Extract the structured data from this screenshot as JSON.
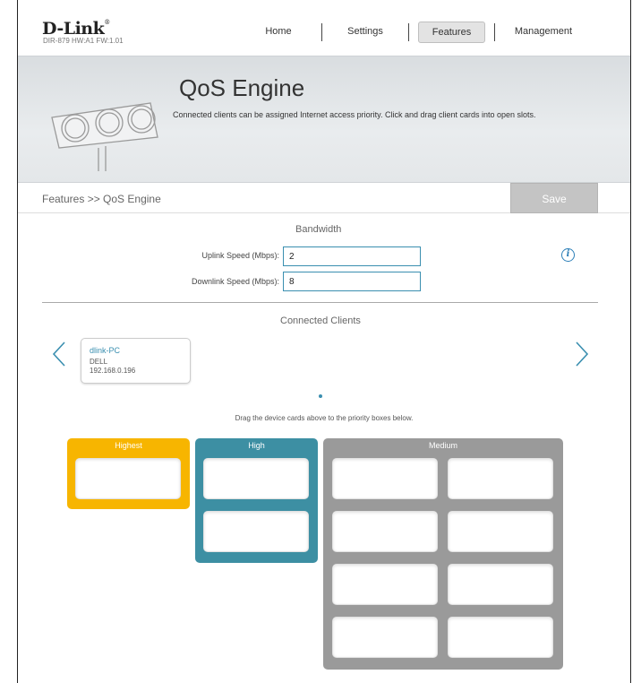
{
  "header": {
    "brand": "D-Link",
    "brand_mark": "®",
    "model_info": "DIR-879 HW:A1 FW:1.01",
    "nav": {
      "home": "Home",
      "settings": "Settings",
      "features": "Features",
      "management": "Management"
    }
  },
  "banner": {
    "title": "QoS Engine",
    "description": "Connected clients can be assigned Internet access priority. Click and drag client cards into open slots.",
    "icon": "traffic-light-icon"
  },
  "breadcrumb": "Features >> QoS Engine",
  "save_label": "Save",
  "bandwidth": {
    "title": "Bandwidth",
    "uplink_label": "Uplink Speed (Mbps):",
    "uplink_value": "2",
    "downlink_label": "Downlink Speed (Mbps):",
    "downlink_value": "8",
    "info_icon": "info-icon"
  },
  "clients": {
    "title": "Connected Clients",
    "items": [
      {
        "name": "dlink-PC",
        "vendor": "DELL",
        "ip": "192.168.0.196"
      }
    ],
    "hint": "Drag the device cards above to the priority boxes below."
  },
  "priority": {
    "highest": {
      "label": "Highest",
      "color": "#f7b500",
      "slots": 1
    },
    "high": {
      "label": "High",
      "color": "#3d8fa3",
      "slots": 2
    },
    "medium": {
      "label": "Medium",
      "color": "#9a9a9a",
      "slots": 8
    }
  },
  "colors": {
    "accent": "#3a8fb0",
    "save_disabled": "#c4c4c4"
  }
}
